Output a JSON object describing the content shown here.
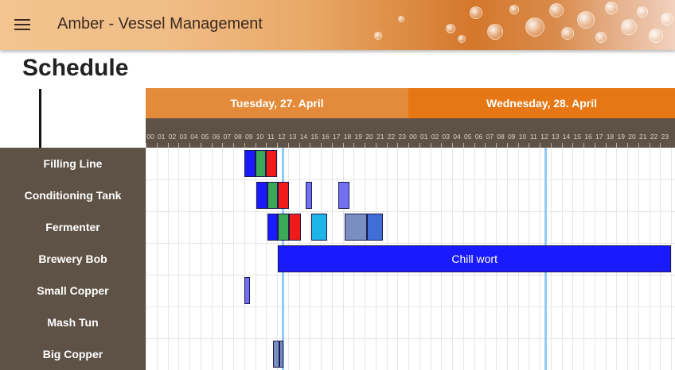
{
  "app": {
    "title": "Amber - Vessel Management"
  },
  "page": {
    "title": "Schedule"
  },
  "days": [
    {
      "label": "Tuesday, 27. April",
      "color": "#e38b3a"
    },
    {
      "label": "Wednesday, 28. April",
      "color": "#e67714"
    }
  ],
  "hours": [
    "00",
    "01",
    "02",
    "03",
    "04",
    "05",
    "06",
    "07",
    "08",
    "09",
    "10",
    "11",
    "12",
    "13",
    "14",
    "15",
    "16",
    "17",
    "18",
    "19",
    "20",
    "21",
    "22",
    "23"
  ],
  "vessels": [
    "Filling Line",
    "Conditioning Tank",
    "Fermenter",
    "Brewery Bob",
    "Small Copper",
    "Mash Tun",
    "Big Copper"
  ],
  "timeline": {
    "now_markers_hour": [
      12.5,
      36.5
    ]
  },
  "colors": {
    "blue": "#1a1aff",
    "green": "#3aa856",
    "red": "#f01a1a",
    "periwinkle": "#7070f0",
    "cyan": "#1eb4e6",
    "slate": "#7a8fc0",
    "marker": "#90caf9"
  },
  "tasks": [
    {
      "row": 0,
      "start": 9.0,
      "end": 10.0,
      "color": "#1a1aff",
      "label": ""
    },
    {
      "row": 0,
      "start": 10.0,
      "end": 11.0,
      "color": "#3aa856",
      "label": ""
    },
    {
      "row": 0,
      "start": 11.0,
      "end": 12.0,
      "color": "#f01a1a",
      "label": ""
    },
    {
      "row": 1,
      "start": 10.1,
      "end": 11.1,
      "color": "#1a1aff",
      "label": ""
    },
    {
      "row": 1,
      "start": 11.1,
      "end": 12.1,
      "color": "#3aa856",
      "label": ""
    },
    {
      "row": 1,
      "start": 12.1,
      "end": 13.1,
      "color": "#f01a1a",
      "label": ""
    },
    {
      "row": 1,
      "start": 14.6,
      "end": 15.2,
      "color": "#7070f0",
      "label": ""
    },
    {
      "row": 1,
      "start": 17.6,
      "end": 18.6,
      "color": "#7070f0",
      "label": ""
    },
    {
      "row": 2,
      "start": 11.1,
      "end": 12.1,
      "color": "#1a1aff",
      "label": ""
    },
    {
      "row": 2,
      "start": 12.1,
      "end": 13.1,
      "color": "#3aa856",
      "label": ""
    },
    {
      "row": 2,
      "start": 13.1,
      "end": 14.2,
      "color": "#f01a1a",
      "label": ""
    },
    {
      "row": 2,
      "start": 15.1,
      "end": 16.6,
      "color": "#1eb4e6",
      "label": ""
    },
    {
      "row": 2,
      "start": 18.2,
      "end": 20.2,
      "color": "#7a8fc0",
      "label": ""
    },
    {
      "row": 2,
      "start": 20.2,
      "end": 21.7,
      "color": "#3f6fd6",
      "label": ""
    },
    {
      "row": 3,
      "start": 12.1,
      "end": 48.0,
      "color": "#1a1aff",
      "label": "Chill wort"
    },
    {
      "row": 4,
      "start": 9.0,
      "end": 9.5,
      "color": "#7070f0",
      "label": ""
    },
    {
      "row": 6,
      "start": 11.6,
      "end": 12.2,
      "color": "#7a8fc0",
      "label": ""
    },
    {
      "row": 6,
      "start": 12.2,
      "end": 12.6,
      "color": "#7a8fc0",
      "label": ""
    }
  ]
}
